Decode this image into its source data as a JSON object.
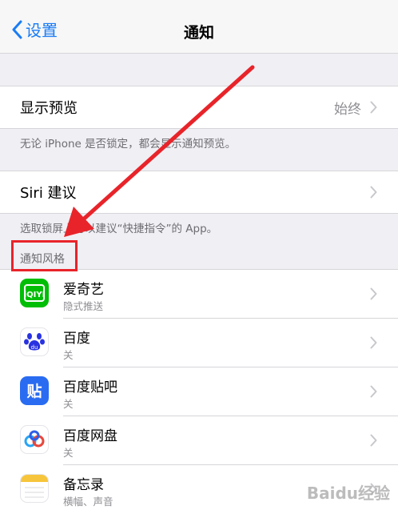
{
  "nav": {
    "back_label": "设置",
    "title": "通知"
  },
  "preview": {
    "label": "显示预览",
    "value": "始终",
    "footer": "无论 iPhone 是否锁定，都会显示通知预览。"
  },
  "siri": {
    "label": "Siri 建议",
    "footer": "选取锁屏上可以建议“快捷指令”的 App。"
  },
  "style_section": {
    "header": "通知风格"
  },
  "apps": [
    {
      "name": "爱奇艺",
      "subtitle": "隐式推送",
      "icon": "iqiyi-icon"
    },
    {
      "name": "百度",
      "subtitle": "关",
      "icon": "baidu-icon"
    },
    {
      "name": "百度贴吧",
      "subtitle": "关",
      "icon": "tieba-icon"
    },
    {
      "name": "百度网盘",
      "subtitle": "关",
      "icon": "baidu-netdisk-icon"
    },
    {
      "name": "备忘录",
      "subtitle": "横幅、声音",
      "icon": "notes-icon"
    }
  ],
  "colors": {
    "ios_blue": "#1a7cf5",
    "annotation_red": "#e8242a",
    "iqiyi_green": "#00be06",
    "baidu_blue": "#2932e1"
  },
  "watermark": "Baidu经验"
}
